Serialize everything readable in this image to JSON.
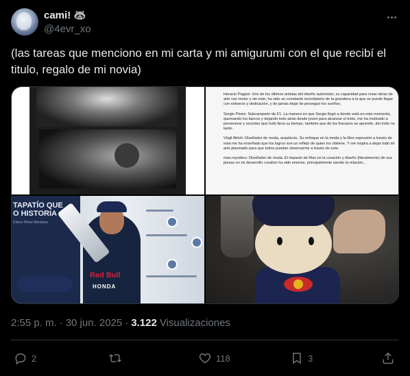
{
  "author": {
    "display_name": "cami!",
    "name_emoji": "🦝",
    "handle": "@4evr_xo"
  },
  "tweet": {
    "text": "(las tareas que menciono en mi carta y mi amigurumi con el que recibí el titulo, regalo de mi novia)"
  },
  "media": {
    "tile_3": {
      "title": "TAPATÍO QUE\nO HISTORIA",
      "subtitle": "Checo Pérez Mendoza",
      "sponsor": "Red Bull",
      "brand": "HONDA"
    },
    "document": {
      "paragraphs": [
        "Horacio Pagani: Uno de los últimos artistas del diseño automotor, su capacidad para crear obras de arte con motor y sin este, ha sido un constante recordatorio de la grandeza a la que se puede llegar con esfuerzo y dedicación, y de jamás dejar de perseguir los sueños.",
        "Sergio Pérez: Subcampeón de F1. La manera en que Sergio llegó a donde está en este momento, quemando los barcos y dejando todo atrás desde joven para alcanzar el éxito, me ha motivado a perseverar y recordar que todo lleva su tiempo, también que de los fracasos se aprende, del éxito no tanto.",
        "Virgil Abloh: Diseñador de moda, arquitecto. Su enfoque en la moda y la libre expresión a través de esta me ha enseñado que los logros son un reflejo de quien los obtiene. Y me inspira a dejar todo mi arte plasmado para que todos puedan observarme a través de este.",
        "max.reynders: Diseñador de moda. El impacto de Max en la creación y diseño (literalmente) de sus piezas en mi desarrollo creativo ha sido enorme, principalmente siendo la relación..."
      ]
    }
  },
  "meta": {
    "time": "2:55 p. m.",
    "separator": "·",
    "date": "30 jun. 2025",
    "separator2": "·",
    "views_count": "3.122",
    "views_label": "Visualizaciones"
  },
  "actions": {
    "replies": "2",
    "retweets": "",
    "likes": "118",
    "bookmarks": "3"
  },
  "icons": [
    "more-icon",
    "reply-icon",
    "retweet-icon",
    "like-icon",
    "bookmark-icon",
    "share-icon"
  ],
  "colors": {
    "background": "#000000",
    "text_primary": "#e7e9ea",
    "text_secondary": "#71767b",
    "divider": "#2f3336"
  }
}
